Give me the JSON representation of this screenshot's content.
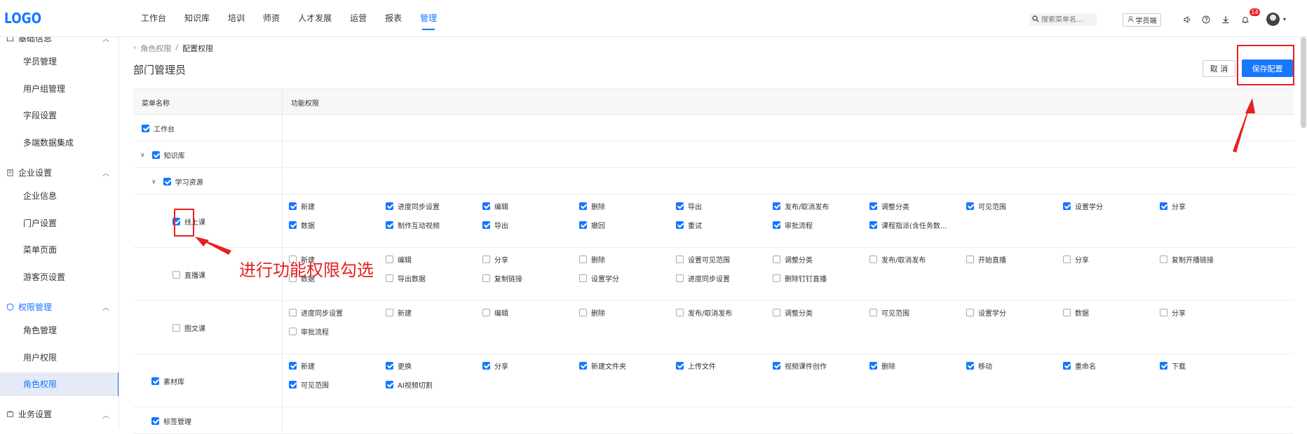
{
  "logo": "LOGO",
  "nav": [
    "工作台",
    "知识库",
    "培训",
    "师资",
    "人才发展",
    "运营",
    "报表",
    "管理"
  ],
  "nav_active_index": 7,
  "search": {
    "placeholder": "搜索菜单名..."
  },
  "student_btn": "学员端",
  "notification_count": "14",
  "sidebar": {
    "groups": [
      {
        "label": "基础信息",
        "items": [
          "学员管理",
          "用户组管理",
          "字段设置",
          "多端数据集成"
        ]
      },
      {
        "label": "企业设置",
        "items": [
          "企业信息",
          "门户设置",
          "菜单页面",
          "游客页设置"
        ]
      },
      {
        "label": "权限管理",
        "items": [
          "角色管理",
          "用户权限",
          "角色权限"
        ]
      },
      {
        "label": "业务设置",
        "items": []
      }
    ],
    "active_item": "角色权限"
  },
  "breadcrumb": {
    "back": "角色权限",
    "sep": "/",
    "current": "配置权限"
  },
  "page_title": "部门管理员",
  "buttons": {
    "cancel": "取 消",
    "save": "保存配置"
  },
  "table": {
    "col_menu": "菜单名称",
    "col_perm": "功能权限",
    "rows": [
      {
        "name": "工作台",
        "checked": true,
        "level": 0,
        "expand": false,
        "perms": []
      },
      {
        "name": "知识库",
        "checked": true,
        "level": 0,
        "expand": true,
        "perms": []
      },
      {
        "name": "学习资源",
        "checked": true,
        "level": 1,
        "expand": true,
        "perms": []
      },
      {
        "name": "线上课",
        "checked": true,
        "level": 2,
        "expand": false,
        "perms": [
          {
            "label": "新建",
            "on": true
          },
          {
            "label": "进度同步设置",
            "on": true
          },
          {
            "label": "编辑",
            "on": true
          },
          {
            "label": "删除",
            "on": true
          },
          {
            "label": "导出",
            "on": true
          },
          {
            "label": "发布/取消发布",
            "on": true
          },
          {
            "label": "调整分类",
            "on": true
          },
          {
            "label": "可见范围",
            "on": true
          },
          {
            "label": "设置学分",
            "on": true
          },
          {
            "label": "分享",
            "on": true
          },
          {
            "label": "数据",
            "on": true
          },
          {
            "label": "制作互动视频",
            "on": true
          },
          {
            "label": "导出",
            "on": true
          },
          {
            "label": "撤回",
            "on": true
          },
          {
            "label": "重试",
            "on": true
          },
          {
            "label": "审批流程",
            "on": true
          },
          {
            "label": "课程指派(含任务数...",
            "on": true
          }
        ]
      },
      {
        "name": "直播课",
        "checked": false,
        "level": 2,
        "expand": false,
        "perms": [
          {
            "label": "新建",
            "on": false
          },
          {
            "label": "编辑",
            "on": false
          },
          {
            "label": "分享",
            "on": false
          },
          {
            "label": "删除",
            "on": false
          },
          {
            "label": "设置可见范围",
            "on": false
          },
          {
            "label": "调整分类",
            "on": false
          },
          {
            "label": "发布/取消发布",
            "on": false
          },
          {
            "label": "开始直播",
            "on": false
          },
          {
            "label": "分享",
            "on": false
          },
          {
            "label": "复制开播链接",
            "on": false
          },
          {
            "label": "数据",
            "on": false
          },
          {
            "label": "导出数据",
            "on": false
          },
          {
            "label": "复制链接",
            "on": false
          },
          {
            "label": "设置学分",
            "on": false
          },
          {
            "label": "进度同步设置",
            "on": false
          },
          {
            "label": "删除钉钉直播",
            "on": false
          }
        ]
      },
      {
        "name": "图文课",
        "checked": false,
        "level": 2,
        "expand": false,
        "perms": [
          {
            "label": "进度同步设置",
            "on": false
          },
          {
            "label": "新建",
            "on": false
          },
          {
            "label": "编辑",
            "on": false
          },
          {
            "label": "删除",
            "on": false
          },
          {
            "label": "发布/取消发布",
            "on": false
          },
          {
            "label": "调整分类",
            "on": false
          },
          {
            "label": "可见范围",
            "on": false
          },
          {
            "label": "设置学分",
            "on": false
          },
          {
            "label": "数据",
            "on": false
          },
          {
            "label": "分享",
            "on": false
          },
          {
            "label": "审批流程",
            "on": false
          }
        ]
      },
      {
        "name": "素材库",
        "checked": true,
        "level": 1,
        "expand": false,
        "perms": [
          {
            "label": "新建",
            "on": true
          },
          {
            "label": "更换",
            "on": true
          },
          {
            "label": "分享",
            "on": true
          },
          {
            "label": "新建文件夹",
            "on": true
          },
          {
            "label": "上传文件",
            "on": true
          },
          {
            "label": "视频课件创作",
            "on": true
          },
          {
            "label": "删除",
            "on": true
          },
          {
            "label": "移动",
            "on": true
          },
          {
            "label": "重命名",
            "on": true
          },
          {
            "label": "下载",
            "on": true
          },
          {
            "label": "可见范围",
            "on": true
          },
          {
            "label": "AI视频切割",
            "on": true
          }
        ]
      },
      {
        "name": "标签管理",
        "checked": true,
        "level": 1,
        "expand": false,
        "perms": []
      }
    ]
  },
  "annotation": {
    "text": "进行功能权限勾选",
    "color": "#e52020"
  },
  "colors": {
    "accent": "#1677ff",
    "annotation": "#e52020"
  }
}
